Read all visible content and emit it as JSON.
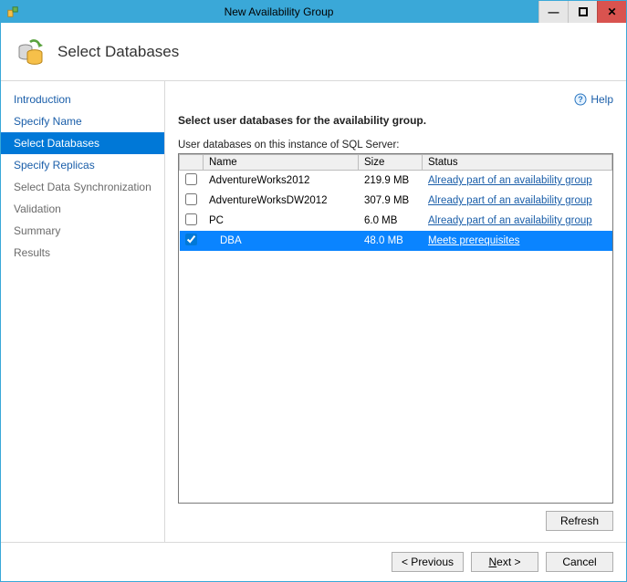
{
  "window": {
    "title": "New Availability Group"
  },
  "header": {
    "page_title": "Select Databases"
  },
  "help": {
    "label": "Help"
  },
  "sidebar": {
    "items": [
      {
        "label": "Introduction",
        "state": "link"
      },
      {
        "label": "Specify Name",
        "state": "link"
      },
      {
        "label": "Select Databases",
        "state": "selected"
      },
      {
        "label": "Specify Replicas",
        "state": "link"
      },
      {
        "label": "Select Data Synchronization",
        "state": "disabled"
      },
      {
        "label": "Validation",
        "state": "disabled"
      },
      {
        "label": "Summary",
        "state": "disabled"
      },
      {
        "label": "Results",
        "state": "disabled"
      }
    ]
  },
  "content": {
    "instruction": "Select user databases for the availability group.",
    "subtext": "User databases on this instance of SQL Server:",
    "columns": {
      "name": "Name",
      "size": "Size",
      "status": "Status"
    },
    "rows": [
      {
        "checked": false,
        "name": "AdventureWorks2012",
        "size": "219.9 MB",
        "status": "Already part of an availability group",
        "selected": false
      },
      {
        "checked": false,
        "name": "AdventureWorksDW2012",
        "size": "307.9 MB",
        "status": "Already part of an availability group",
        "selected": false
      },
      {
        "checked": false,
        "name": "PC",
        "size": "6.0 MB",
        "status": "Already part of an availability group",
        "selected": false
      },
      {
        "checked": true,
        "name": "DBA",
        "size": "48.0 MB",
        "status": "Meets prerequisites",
        "selected": true
      }
    ],
    "refresh": "Refresh"
  },
  "footer": {
    "previous": "< Previous",
    "next": "Next >",
    "cancel": "Cancel"
  }
}
